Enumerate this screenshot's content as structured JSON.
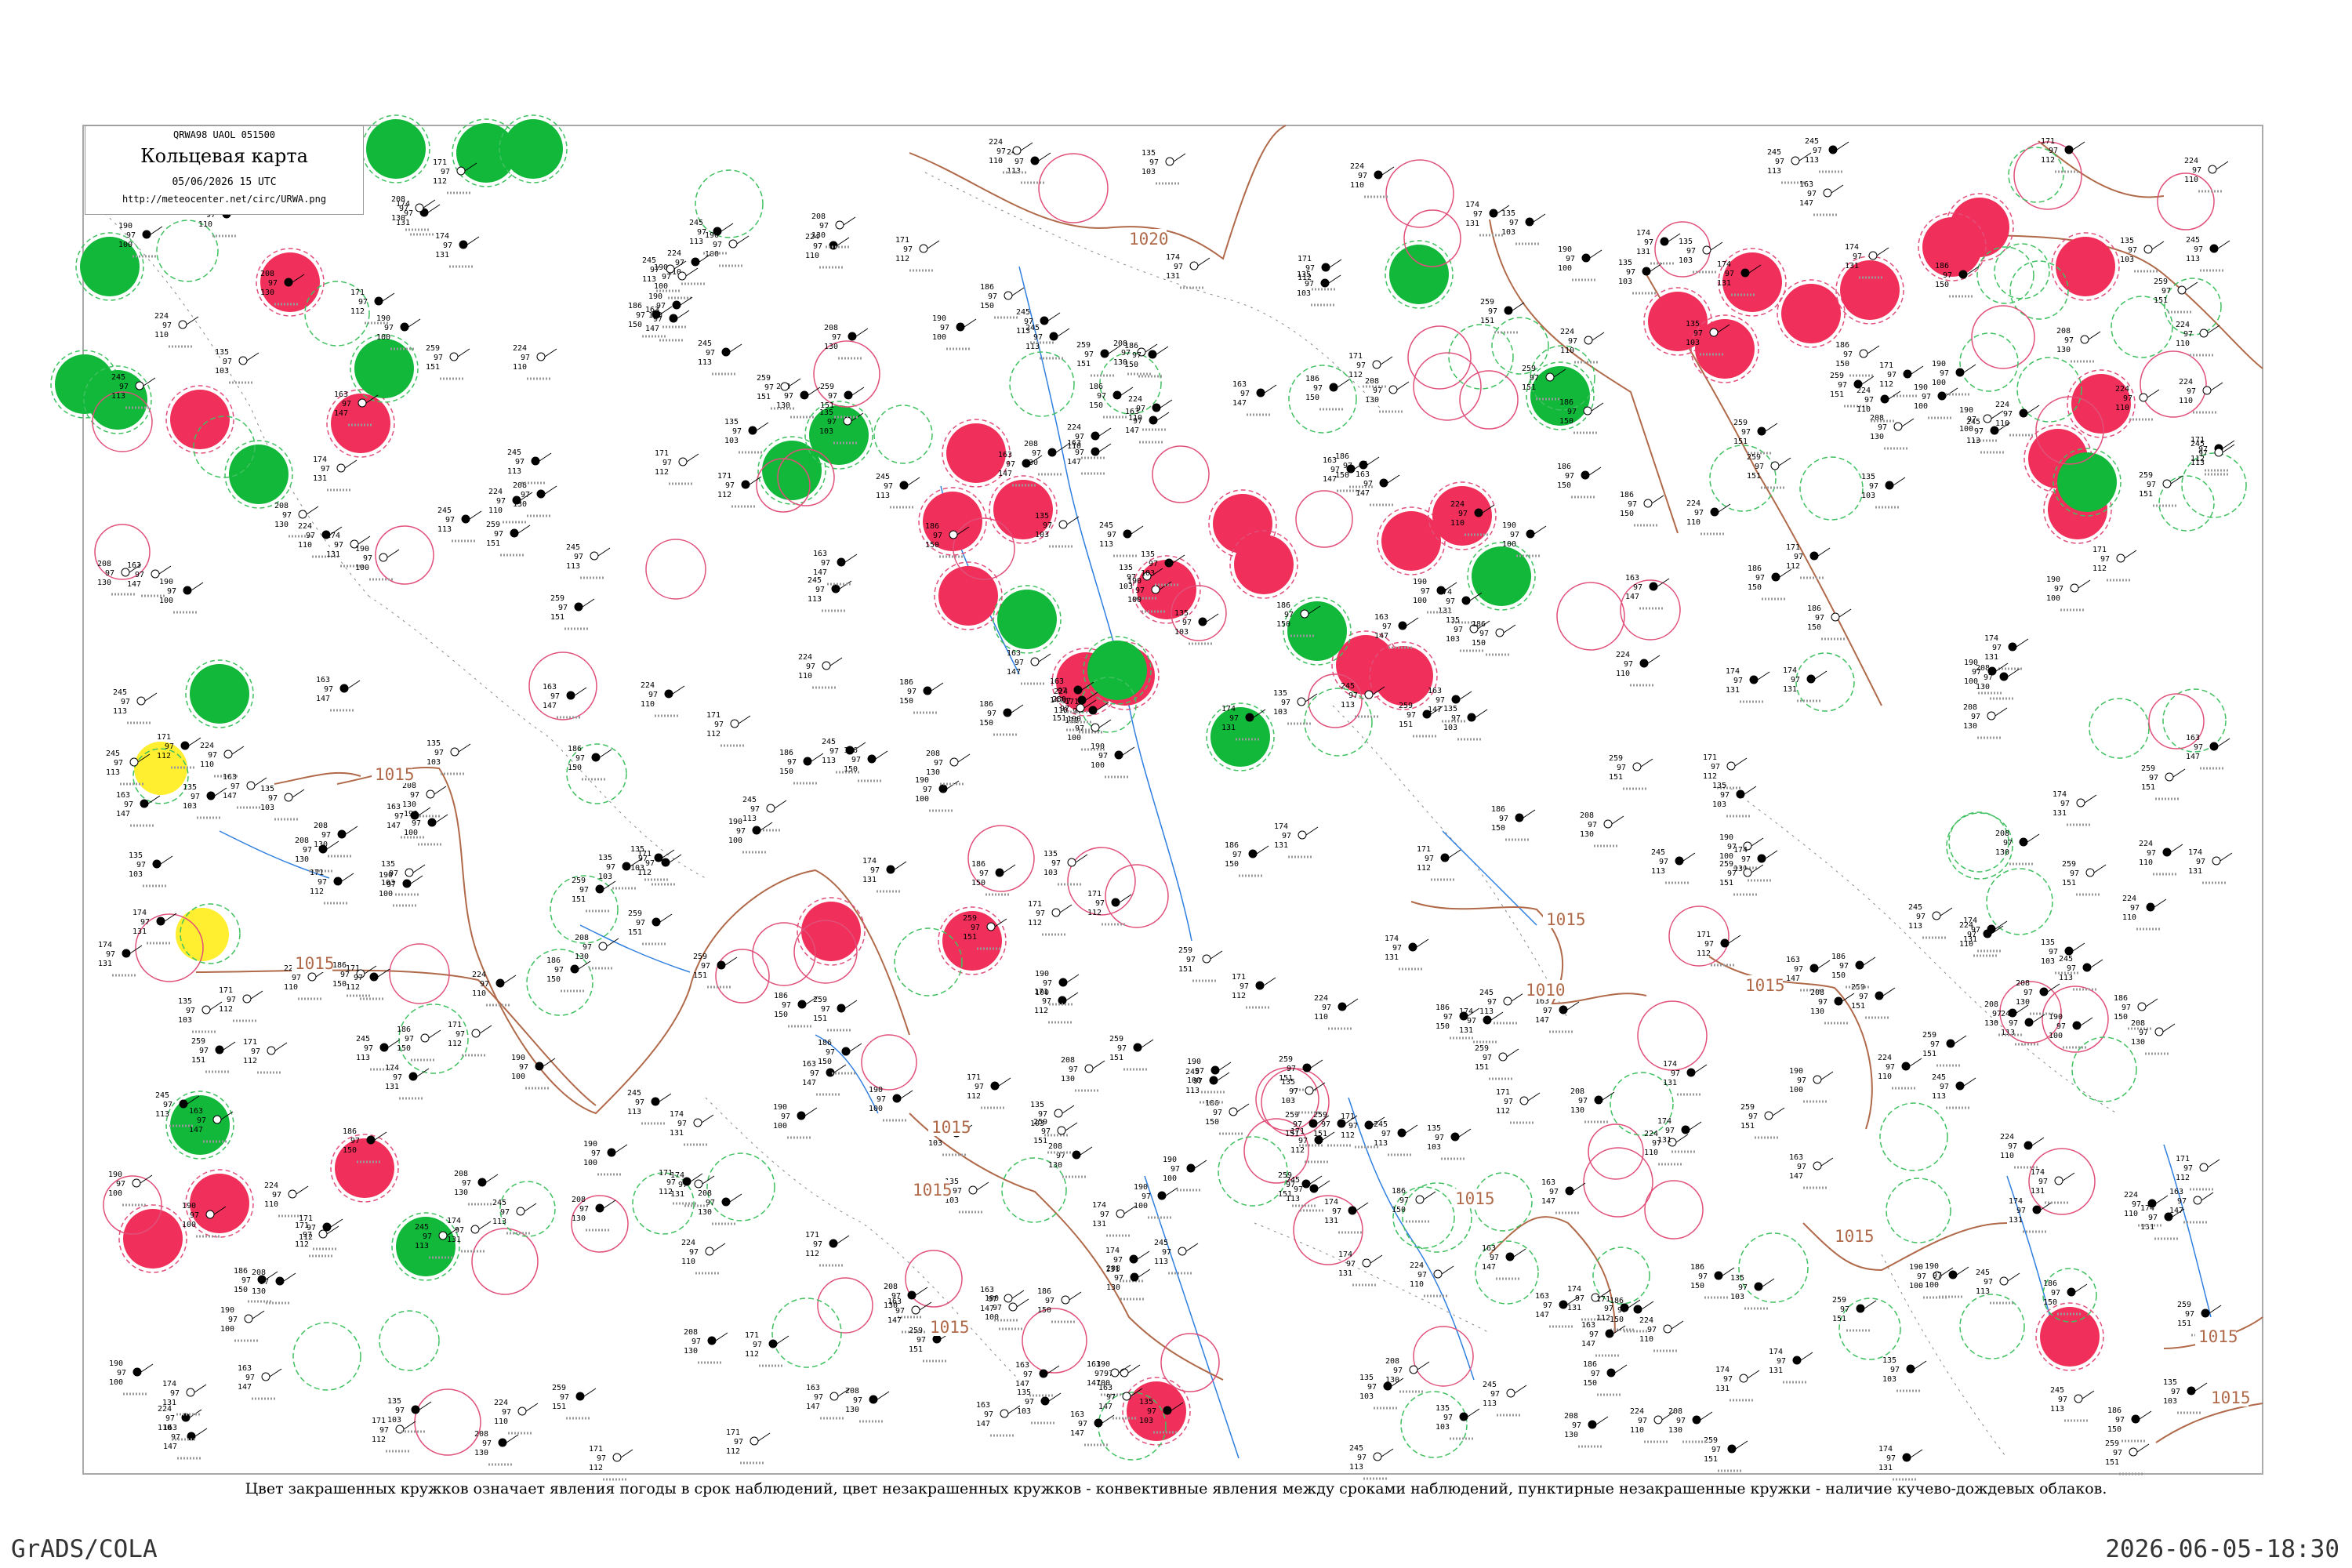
{
  "header": {
    "code_line": "QRWA98  UAOL  051500",
    "title": "Кольцевая карта",
    "date": "05/06/2026 15 UTC",
    "url": "http://meteocenter.net/circ/URWA.png"
  },
  "caption": "Цвет закрашенных кружков означает явления погоды в срок наблюдений, цвет незакрашенных кружков - конвективные явления между сроками наблюдений, пунктирные незакрашенные кружки - наличие кучево-дождевых облаков.",
  "footer": {
    "left": "GrADS/COLA",
    "right": "2026-06-05-18:30"
  },
  "isobar_labels": [
    "1020",
    "1015",
    "1015",
    "1015",
    "1015",
    "1015",
    "1015",
    "1015",
    "1015",
    "1015",
    "1010",
    "1015",
    "1015"
  ],
  "colors": {
    "thunderstorm_red": "#f0305a",
    "shower_green": "#12b83a",
    "fog_yellow": "#ffef30",
    "convective_ring_red": "#e0507a",
    "cb_ring_green": "#40c060",
    "isobar": "#b06a4a",
    "river": "#2f7fe0",
    "border": "#888888"
  },
  "legend": {
    "filled_circle": "weather phenomena at observation time",
    "open_circle": "convective phenomena between observation times",
    "dashed_open_circle": "cumulonimbus clouds present"
  },
  "station_samples": [
    {
      "t": "163",
      "p": "97",
      "v": "147"
    },
    {
      "t": "245",
      "p": "97",
      "v": "113"
    },
    {
      "t": "259",
      "p": "97",
      "v": "151"
    },
    {
      "t": "174",
      "p": "97",
      "v": "131"
    },
    {
      "t": "186",
      "p": "97",
      "v": "150"
    },
    {
      "t": "224",
      "p": "97",
      "v": "110"
    },
    {
      "t": "135",
      "p": "97",
      "v": "103"
    },
    {
      "t": "171",
      "p": "97",
      "v": "112"
    },
    {
      "t": "208",
      "p": "97",
      "v": "130"
    },
    {
      "t": "190",
      "p": "97",
      "v": "100"
    }
  ]
}
